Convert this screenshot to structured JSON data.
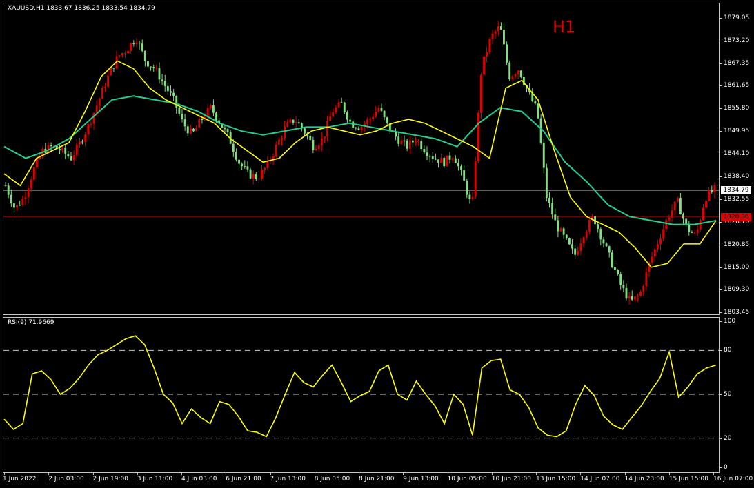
{
  "header": {
    "symbol_line": "XAUUSD,H1  1833.67 1836.25 1833.54 1834.79",
    "timeframe_label": "H1"
  },
  "rsi_header": "RSI(9) 71.9669",
  "price_labels": {
    "current": "1834.79",
    "line": "1828.06"
  },
  "colors": {
    "bull": "#e00000",
    "bear": "#7fe07f",
    "ma_fast": "#ffff00",
    "ma_slow": "#20d090",
    "rsi": "#ffff00",
    "hline_current": "#c0c0c0",
    "hline_level": "#e00000"
  },
  "chart_data": [
    {
      "type": "candlestick",
      "symbol": "XAUUSD",
      "timeframe": "H1",
      "ylim": [
        1803.45,
        1879.05
      ],
      "y_ticks": [
        "1879.05",
        "1873.20",
        "1867.35",
        "1861.65",
        "1855.80",
        "1849.95",
        "1844.10",
        "1838.40",
        "1832.55",
        "1826.70",
        "1820.85",
        "1815.00",
        "1809.30",
        "1803.45"
      ],
      "x_ticks": [
        "1 Jun 2022",
        "2 Jun 03:00",
        "2 Jun 19:00",
        "3 Jun 11:00",
        "4 Jun 03:00",
        "6 Jun 21:00",
        "7 Jun 13:00",
        "8 Jun 05:00",
        "8 Jun 21:00",
        "9 Jun 13:00",
        "10 Jun 05:00",
        "10 Jun 21:00",
        "13 Jun 15:00",
        "14 Jun 07:00",
        "14 Jun 23:00",
        "15 Jun 15:00",
        "16 Jun 07:00"
      ],
      "last_close": 1834.79,
      "horizontal_line": 1828.06,
      "close_path": [
        1836,
        1830,
        1833,
        1840,
        1845,
        1846,
        1845,
        1843,
        1847,
        1852,
        1858,
        1864,
        1869,
        1871,
        1874,
        1868,
        1866,
        1862,
        1858,
        1852,
        1849,
        1853,
        1856,
        1852,
        1848,
        1842,
        1839,
        1838,
        1841,
        1846,
        1851,
        1853,
        1850,
        1846,
        1848,
        1855,
        1857,
        1852,
        1851,
        1853,
        1856,
        1851,
        1848,
        1846,
        1848,
        1845,
        1843,
        1842,
        1844,
        1838,
        1830,
        1866,
        1874,
        1877,
        1864,
        1866,
        1860,
        1855,
        1833,
        1826,
        1822,
        1818,
        1824,
        1828,
        1822,
        1816,
        1810,
        1806,
        1808,
        1816,
        1822,
        1828,
        1832,
        1825,
        1823,
        1833,
        1835
      ],
      "ma_fast": [
        1839,
        1836,
        1843,
        1845,
        1847,
        1855,
        1864,
        1868,
        1866,
        1861,
        1858,
        1856,
        1854,
        1852,
        1848,
        1845,
        1842,
        1843,
        1847,
        1850,
        1851,
        1850,
        1849,
        1850,
        1852,
        1853,
        1852,
        1850,
        1848,
        1846,
        1843,
        1861,
        1863,
        1858,
        1845,
        1833,
        1828,
        1826,
        1824,
        1820,
        1815,
        1816,
        1821,
        1821,
        1827
      ],
      "ma_slow": [
        1846,
        1843,
        1845,
        1848,
        1853,
        1858,
        1859,
        1858,
        1857,
        1855,
        1852,
        1850,
        1849,
        1850,
        1851,
        1851,
        1852,
        1851,
        1850,
        1849,
        1848,
        1846,
        1852,
        1856,
        1855,
        1850,
        1842,
        1837,
        1831,
        1828,
        1827,
        1826,
        1826,
        1827
      ]
    },
    {
      "type": "line",
      "title": "RSI(9) 71.9669",
      "ylim": [
        0,
        100
      ],
      "y_ticks": [
        0,
        20,
        50,
        80,
        100
      ],
      "levels": [
        20,
        50,
        80
      ],
      "values": [
        33,
        26,
        30,
        64,
        66,
        60,
        50,
        54,
        61,
        70,
        77,
        80,
        84,
        88,
        90,
        84,
        68,
        50,
        44,
        30,
        40,
        34,
        30,
        45,
        43,
        35,
        25,
        24,
        21,
        34,
        50,
        65,
        58,
        55,
        63,
        70,
        58,
        45,
        49,
        52,
        66,
        70,
        50,
        46,
        59,
        50,
        42,
        30,
        50,
        43,
        22,
        68,
        73,
        74,
        53,
        50,
        41,
        27,
        22,
        21,
        25,
        43,
        56,
        49,
        35,
        29,
        26,
        34,
        42,
        52,
        61,
        79,
        48,
        55,
        64,
        68,
        70
      ]
    }
  ]
}
